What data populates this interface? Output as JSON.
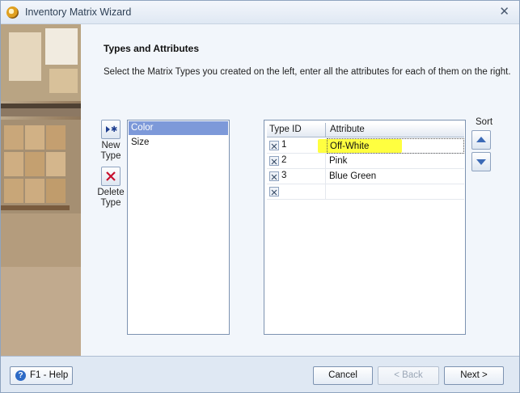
{
  "window": {
    "title": "Inventory Matrix Wizard",
    "close_glyph": "✕"
  },
  "page": {
    "heading": "Types and Attributes",
    "instruction": "Select the Matrix Types you created on the left, enter all the attributes for each of them on the right."
  },
  "type_tools": {
    "new_label": "New\nType",
    "delete_label": "Delete\nType"
  },
  "types": {
    "items": [
      {
        "label": "Color",
        "selected": true
      },
      {
        "label": "Size",
        "selected": false
      }
    ]
  },
  "attributes_grid": {
    "columns": [
      "Type ID",
      "Attribute"
    ],
    "rows": [
      {
        "id": "1",
        "attribute": "Off-White",
        "highlighted": true
      },
      {
        "id": "2",
        "attribute": "Pink"
      },
      {
        "id": "3",
        "attribute": "Blue Green"
      },
      {
        "id": "",
        "attribute": ""
      }
    ]
  },
  "sort": {
    "label": "Sort"
  },
  "footer": {
    "help_label": "F1 - Help",
    "cancel_label": "Cancel",
    "back_label": "< Back",
    "next_label": "Next >"
  },
  "colors": {
    "selection": "#7d99d9",
    "highlight": "#ffff40",
    "accent_blue": "#2e6bc6"
  }
}
